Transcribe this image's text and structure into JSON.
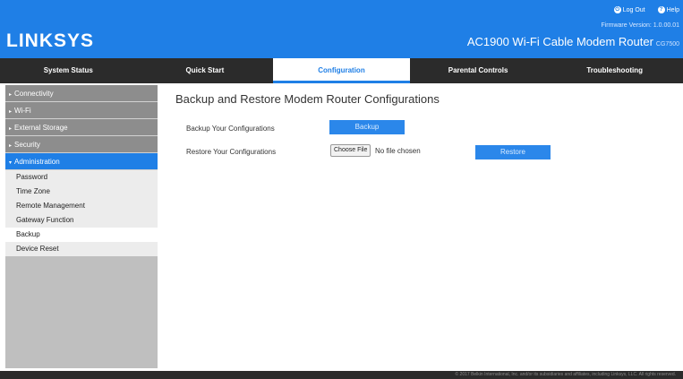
{
  "header": {
    "logo": "LINKSYS",
    "logout_label": "Log Out",
    "help_label": "Help",
    "firmware": "Firmware Version: 1.0.00.01",
    "model": "AC1900 Wi-Fi Cable Modem Router",
    "model_number": "CG7500"
  },
  "nav": {
    "tabs": [
      {
        "label": "System Status"
      },
      {
        "label": "Quick Start"
      },
      {
        "label": "Configuration"
      },
      {
        "label": "Parental Controls"
      },
      {
        "label": "Troubleshooting"
      }
    ],
    "active": "Configuration"
  },
  "sidebar": {
    "categories": [
      {
        "label": "Connectivity"
      },
      {
        "label": "Wi-Fi"
      },
      {
        "label": "External Storage"
      },
      {
        "label": "Security"
      },
      {
        "label": "Administration"
      }
    ],
    "sub_items": [
      {
        "label": "Password"
      },
      {
        "label": "Time Zone"
      },
      {
        "label": "Remote Management"
      },
      {
        "label": "Gateway Function"
      },
      {
        "label": "Backup"
      },
      {
        "label": "Device Reset"
      }
    ],
    "active_category": "Administration",
    "active_item": "Backup"
  },
  "main": {
    "title": "Backup and Restore Modem Router Configurations",
    "backup_label": "Backup Your Configurations",
    "backup_button": "Backup",
    "restore_label": "Restore Your Configurations",
    "choose_file_button": "Choose File",
    "no_file_text": "No file chosen",
    "restore_button": "Restore"
  },
  "footer": {
    "copyright": "© 2017 Belkin International, Inc. and/or its subsidiaries and affiliates, including Linksys, LLC. All rights reserved."
  },
  "colors": {
    "brand_blue": "#1f7fe6",
    "nav_bg": "#2b2b2b",
    "sidebar_bg": "#bfbfbf"
  }
}
